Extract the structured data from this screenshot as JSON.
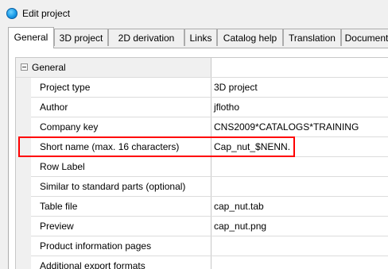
{
  "window": {
    "title": "Edit project"
  },
  "tabs": [
    {
      "label": "General",
      "active": true
    },
    {
      "label": "3D project"
    },
    {
      "label": "2D derivation"
    },
    {
      "label": "Links"
    },
    {
      "label": "Catalog help"
    },
    {
      "label": "Translation"
    },
    {
      "label": "Documents"
    }
  ],
  "grid": {
    "group": "General",
    "rows": [
      {
        "name": "Project type",
        "value": "3D project"
      },
      {
        "name": "Author",
        "value": "jflotho"
      },
      {
        "name": "Company key",
        "value": "CNS2009*CATALOGS*TRAINING"
      },
      {
        "name": "Short name (max. 16 characters)",
        "value": "Cap_nut_$NENN."
      },
      {
        "name": "Row Label",
        "value": ""
      },
      {
        "name": "Similar to standard parts (optional)",
        "value": ""
      },
      {
        "name": "Table file",
        "value": "cap_nut.tab"
      },
      {
        "name": "Preview",
        "value": "cap_nut.png"
      },
      {
        "name": "Product information pages",
        "value": ""
      },
      {
        "name": "Additional export formats",
        "value": ""
      }
    ]
  },
  "colors": {
    "highlight": "#ff0000",
    "app_icon": "#1a9be8"
  }
}
